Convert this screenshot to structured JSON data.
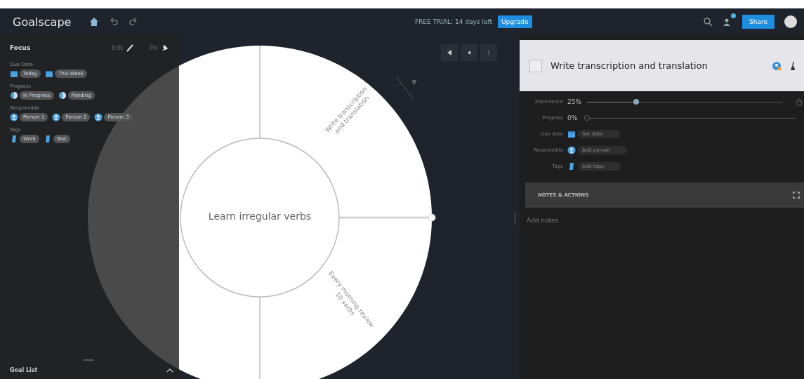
{
  "topbar": {
    "logo": "Goalscape",
    "trial": "FREE TRIAL: 14 days left",
    "upgrade": "Upgrade",
    "share": "Share",
    "notification_badge": true
  },
  "focus": {
    "title": "Focus",
    "edit": "Edit",
    "pin": "Pin",
    "groups": [
      {
        "label": "Due Date",
        "kind": "date",
        "chips": [
          "Today",
          "This Week"
        ]
      },
      {
        "label": "Progress",
        "kind": "progress",
        "chips": [
          "In Progress",
          "Pending"
        ]
      },
      {
        "label": "Responsible",
        "kind": "person",
        "chips": [
          "Person 1",
          "Person 2",
          "Person 3"
        ]
      },
      {
        "label": "Tags",
        "kind": "tag",
        "chips": [
          "Work",
          "Test"
        ]
      }
    ]
  },
  "goal_list": {
    "title": "Goal List",
    "expanded": false
  },
  "map": {
    "center": "Learn irregular verbs",
    "segments": [
      {
        "label": [
          "Write transcription",
          "and translation"
        ]
      },
      {
        "label": [
          "Every morning review",
          "10 verbs"
        ]
      }
    ]
  },
  "detail": {
    "title": "Write transcription and translation",
    "checked": false,
    "rows": [
      {
        "kind": "slider",
        "label": "Importance",
        "reading": "25%",
        "level": 0.25
      },
      {
        "kind": "slider",
        "label": "Progress",
        "reading": "0%",
        "level": 0
      },
      {
        "kind": "chip",
        "label": "Due date",
        "value": "Set date"
      },
      {
        "kind": "chip",
        "label": "Responsible",
        "value": "Add person"
      },
      {
        "kind": "chip",
        "label": "Tags",
        "value": "Add tags"
      }
    ],
    "notes_title": "NOTES & ACTIONS",
    "notes_placeholder": "Add notes"
  }
}
